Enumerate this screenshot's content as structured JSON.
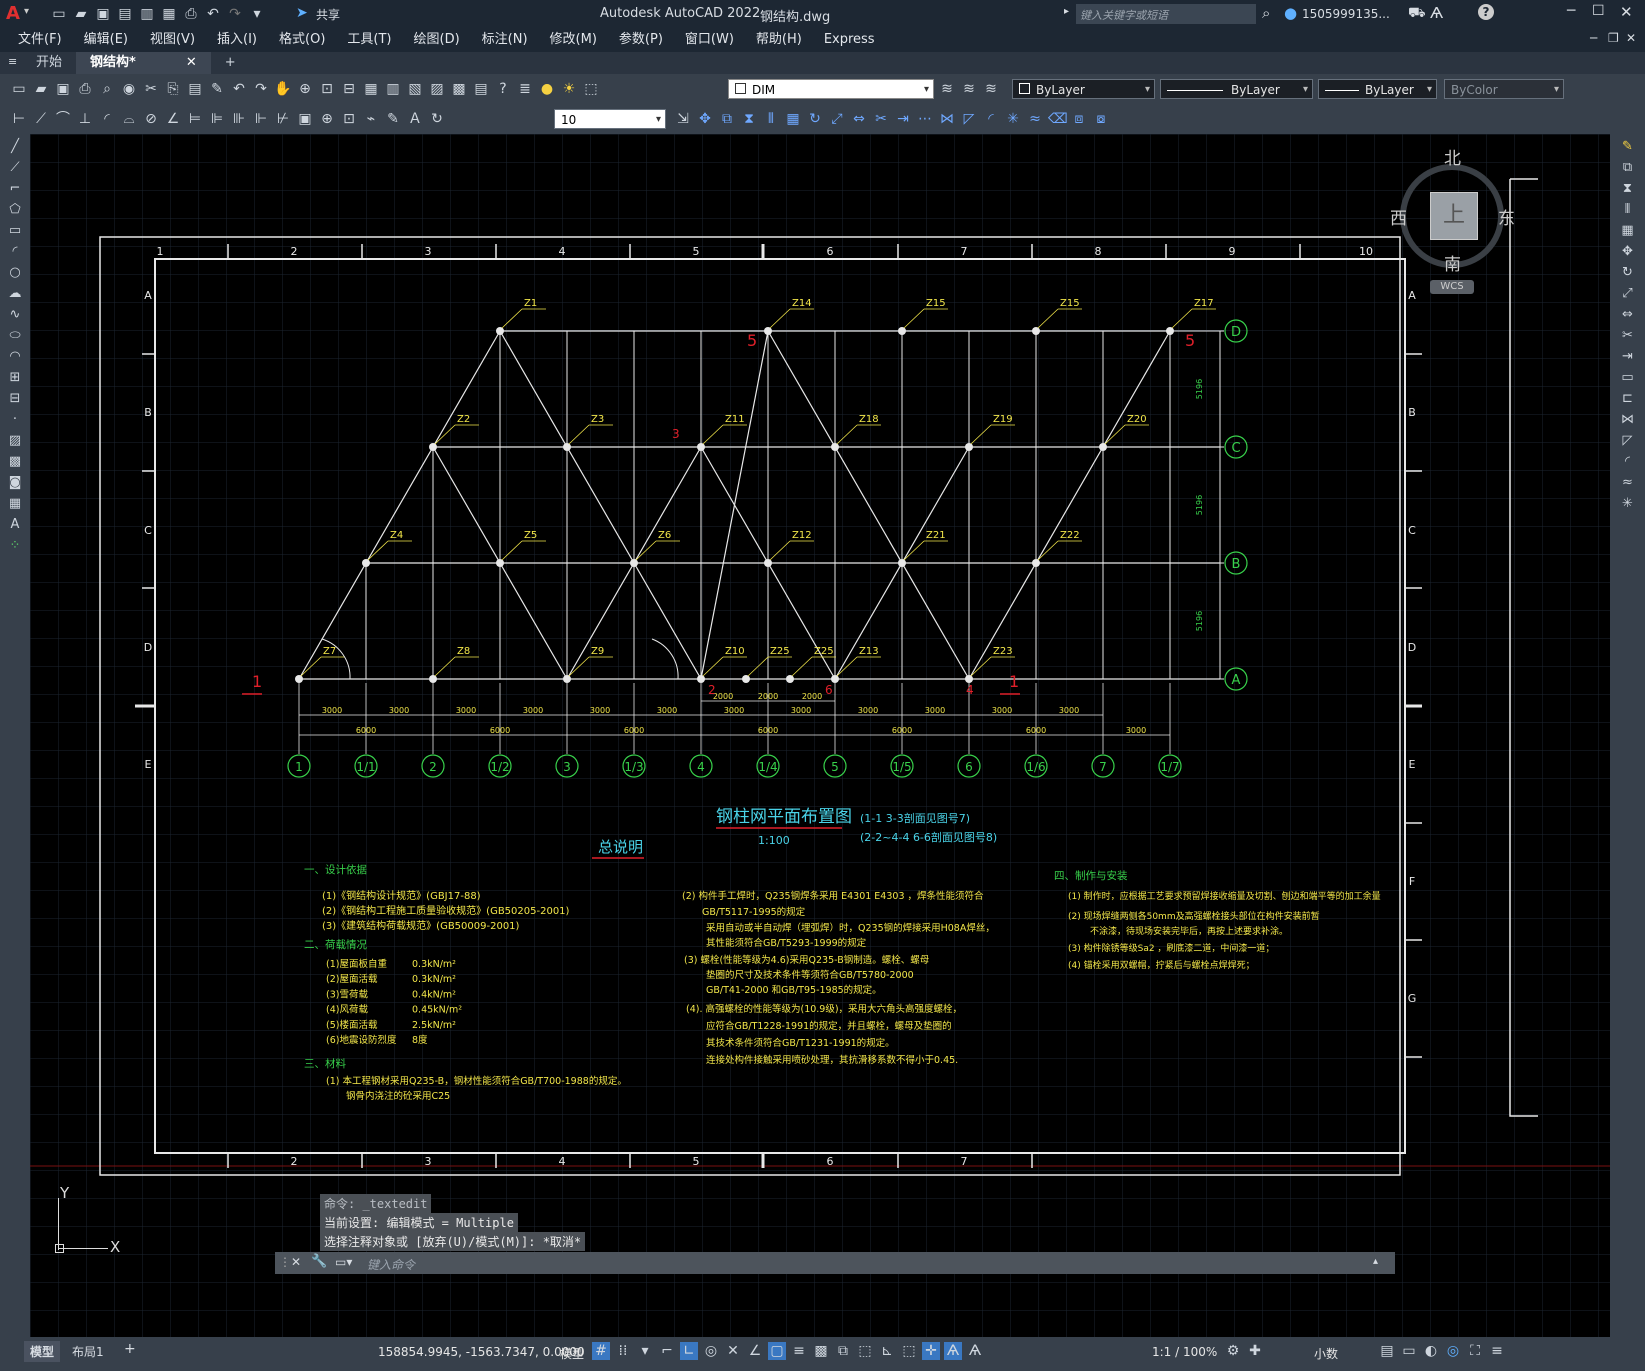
{
  "app": {
    "title": "Autodesk AutoCAD 2022",
    "filename": "钢结构.dwg",
    "search_placeholder": "键入关键字或短语",
    "user": "1505999135...",
    "share": "共享"
  },
  "menu": [
    "文件(F)",
    "编辑(E)",
    "视图(V)",
    "插入(I)",
    "格式(O)",
    "工具(T)",
    "绘图(D)",
    "标注(N)",
    "修改(M)",
    "参数(P)",
    "窗口(W)",
    "帮助(H)",
    "Express"
  ],
  "tabs": {
    "start": "开始",
    "doc": "钢结构*",
    "add": "+"
  },
  "toolbar": {
    "dimstyle": "DIM",
    "layer_color": "ByLayer",
    "linetype": "ByLayer",
    "lineweight": "ByLayer",
    "plotstyle": "ByColor",
    "textheight": "10"
  },
  "viewcube": {
    "north": "北",
    "south": "南",
    "east": "东",
    "west": "西",
    "top": "上",
    "wcs": "WCS"
  },
  "drawing": {
    "border_cols_top": [
      "1",
      "2",
      "3",
      "4",
      "5",
      "6",
      "7",
      "8",
      "9",
      "10"
    ],
    "border_cols_bottom": [
      "2",
      "3",
      "4",
      "5",
      "6",
      "7"
    ],
    "border_rows_left": [
      "A",
      "B",
      "C",
      "D",
      "E"
    ],
    "border_rows_right": [
      "A",
      "B",
      "C",
      "D",
      "E",
      "F",
      "G"
    ],
    "col_markers": [
      "Z1",
      "Z2",
      "Z3",
      "Z4",
      "Z5",
      "Z6",
      "Z7",
      "Z8",
      "Z9",
      "Z10",
      "Z11",
      "Z12",
      "Z13",
      "Z14",
      "Z15",
      "Z15",
      "Z17",
      "Z18",
      "Z19",
      "Z20",
      "Z21",
      "Z22",
      "Z23",
      "Z25",
      "Z25"
    ],
    "axis_circles_bottom": [
      "1",
      "1/1",
      "2",
      "1/2",
      "3",
      "1/3",
      "4",
      "1/4",
      "5",
      "1/5",
      "6",
      "1/6",
      "7",
      "1/7"
    ],
    "axis_circles_right": [
      "D",
      "C",
      "B",
      "A"
    ],
    "dims_3000": "3000",
    "dims_6000": "6000",
    "dims_2000": "2000",
    "dims_5196": "5196",
    "section_marks": [
      "1",
      "1",
      "5",
      "5",
      "2",
      "3",
      "4",
      "6"
    ],
    "plan_title": "钢柱网平面布置图",
    "plan_scale": "1:100",
    "plan_note1": "(1-1 3-3剖面见图号7)",
    "plan_note2": "(2-2~4-4  6-6剖面见图号8)",
    "notes_title": "总说明",
    "sec1_title": "一、设计依据",
    "sec1": [
      "(1)《钢结构设计规范》(GBJ17-88)",
      "(2)《钢结构工程施工质量验收规范》(GB50205-2001)",
      "(3)《建筑结构荷载规范》(GB50009-2001)"
    ],
    "sec2_title": "二、荷载情况",
    "sec2_items": [
      {
        "k": "(1)屋面板自重",
        "v": "0.3kN/m²"
      },
      {
        "k": "(2)屋面活载",
        "v": "0.3kN/m²"
      },
      {
        "k": "(3)雪荷载",
        "v": "0.4kN/m²"
      },
      {
        "k": "(4)风荷载",
        "v": "0.45kN/m²"
      },
      {
        "k": "(5)楼面活载",
        "v": "2.5kN/m²"
      },
      {
        "k": "(6)地震设防烈度",
        "v": "8度"
      }
    ],
    "sec3_title": "三、材料",
    "sec3": [
      "(1)  本工程钢材采用Q235-B，钢材性能须符合GB/T700-1988的规定。",
      "钢骨内浇注的砼采用C25"
    ],
    "mid": [
      "(2)  构件手工焊时，Q235钢焊条采用 E4301  E4303 ，焊条性能须符合",
      "GB/T5117-1995的规定",
      "采用自动或半自动焊（埋弧焊）时，Q235钢的焊接采用H08A焊丝，",
      "其性能须符合GB/T5293-1999的规定",
      "(3)  螺栓(性能等级为4.6)采用Q235-B钢制造。螺栓、螺母",
      "垫圈的尺寸及技术条件等须符合GB/T5780-2000",
      "GB/T41-2000  和GB/T95-1985的规定。",
      "(4).  高强螺栓的性能等级为(10.9级)，采用大六角头高强度螺栓，",
      "应符合GB/T1228-1991的规定，并且螺栓，螺母及垫圈的",
      "其技术条件须符合GB/T1231-1991的规定。",
      "连接处构件接触采用喷砂处理，其抗滑移系数不得小于0.45."
    ],
    "sec4_title": "四、制作与安装",
    "sec4": [
      "(1)  制作时，应根据工艺要求预留焊接收缩量及切割、刨边和端平等的加工余量",
      "(2)  现场焊缝两侧各50mm及高强螺栓接头部位在构件安装前暂",
      "不涂漆，待现场安装完毕后，再按上述要求补涂。",
      "(3)  构件除锈等级Sa2 ，刷底漆二道，中间漆一道；",
      "(4)  锚栓采用双螺帽，拧紧后与螺栓点焊焊死；"
    ]
  },
  "command": {
    "history": [
      "命令: _textedit",
      "当前设置: 编辑模式 = Multiple",
      "选择注释对象或 [放弃(U)/模式(M)]: *取消*"
    ],
    "placeholder": "键入命令"
  },
  "ucs": {
    "x": "X",
    "y": "Y"
  },
  "status": {
    "model_tab": "模型",
    "layout_tab": "布局1",
    "add": "+",
    "coords": "158854.9945, -1563.7347, 0.0000",
    "space": "模型",
    "scale": "1:1 / 100%",
    "units": "小数"
  }
}
